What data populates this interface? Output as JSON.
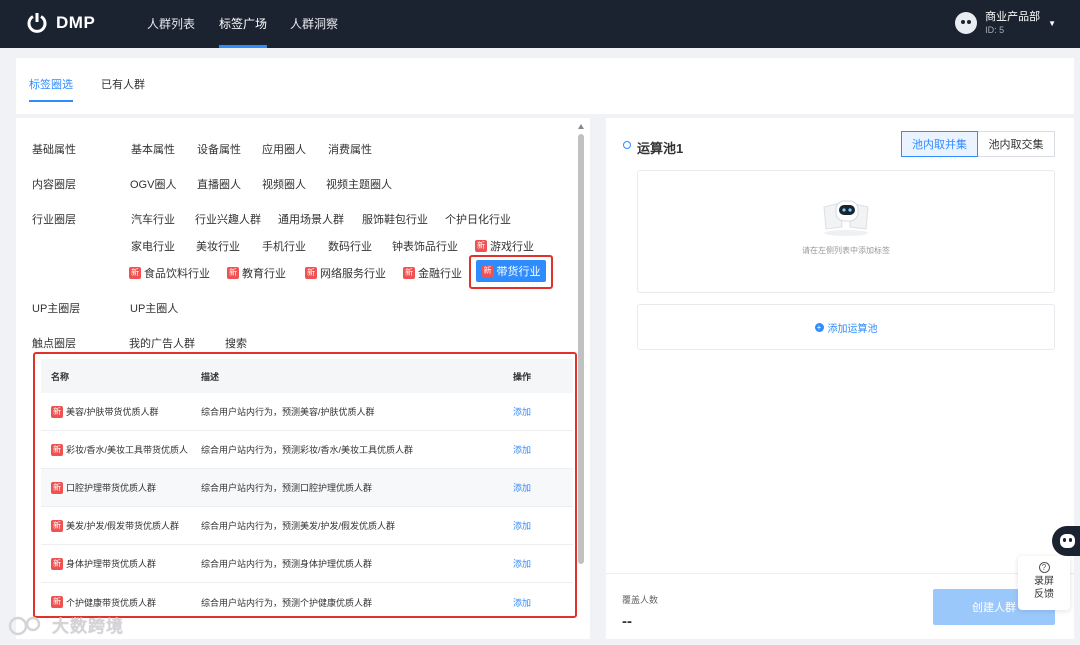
{
  "header": {
    "logo_text": "DMP",
    "nav": [
      "人群列表",
      "标签广场",
      "人群洞察"
    ],
    "active_nav": "标签广场",
    "user": {
      "name": "商业产品部",
      "id": "ID: 5"
    }
  },
  "tabs": [
    "标签圈选",
    "已有人群"
  ],
  "categories": [
    {
      "label": "基础属性",
      "tags": [
        "基本属性",
        "设备属性",
        "应用圈人",
        "消费属性"
      ]
    },
    {
      "label": "内容圈层",
      "tags": [
        "OGV圈人",
        "直播圈人",
        "视频圈人",
        "视频主题圈人"
      ]
    },
    {
      "label": "行业圈层",
      "tags": [
        "汽车行业",
        "行业兴趣人群",
        "通用场景人群",
        "服饰鞋包行业",
        "个护日化行业",
        "家电行业",
        "美妆行业",
        "手机行业",
        "数码行业",
        "钟表饰品行业",
        "游戏行业",
        "食品饮料行业",
        "教育行业",
        "网络服务行业",
        "金融行业",
        "带货行业"
      ]
    },
    {
      "label": "UP主圈层",
      "tags": [
        "UP主圈人"
      ]
    },
    {
      "label": "触点圈层",
      "tags": [
        "我的广告人群",
        "搜索"
      ]
    }
  ],
  "new_badge": "新",
  "selected_tag": "带货行业",
  "table": {
    "headers": {
      "name": "名称",
      "desc": "描述",
      "op": "操作"
    },
    "action_label": "添加",
    "rows": [
      {
        "name": "美容/护肤带货优质人群",
        "desc": "综合用户站内行为，预测美容/护肤优质人群"
      },
      {
        "name": "彩妆/香水/美妆工具带货优质人",
        "desc": "综合用户站内行为，预测彩妆/香水/美妆工具优质人群"
      },
      {
        "name": "口腔护理带货优质人群",
        "desc": "综合用户站内行为，预测口腔护理优质人群"
      },
      {
        "name": "美发/护发/假发带货优质人群",
        "desc": "综合用户站内行为，预测美发/护发/假发优质人群"
      },
      {
        "name": "身体护理带货优质人群",
        "desc": "综合用户站内行为，预测身体护理优质人群"
      },
      {
        "name": "个护健康带货优质人群",
        "desc": "综合用户站内行为，预测个护健康优质人群"
      }
    ]
  },
  "pool": {
    "title": "运算池1",
    "union_label": "池内取并集",
    "intersect_label": "池内取交集",
    "empty_text": "请在左侧列表中添加标签",
    "add_pool_label": "添加运算池"
  },
  "footer": {
    "cover_label": "覆盖人数",
    "cover_value": "--",
    "create_label": "创建人群"
  },
  "feedback": {
    "line1": "录屏",
    "line2": "反馈"
  },
  "watermark": "大数跨境",
  "colors": {
    "primary": "#2f8cff",
    "header_bg": "#1c2330",
    "highlight": "#e1322a",
    "new_badge": "#f05151"
  }
}
